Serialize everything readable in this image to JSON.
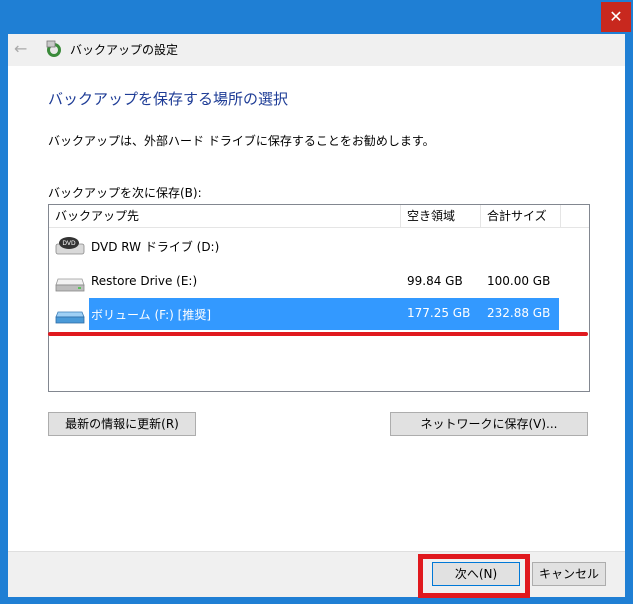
{
  "window": {
    "title": "バックアップの設定",
    "close_glyph": "✕",
    "back_glyph": "←"
  },
  "page": {
    "heading": "バックアップを保存する場所の選択",
    "description": "バックアップは、外部ハード ドライブに保存することをお勧めします。",
    "list_label": "バックアップを次に保存(B):"
  },
  "columns": {
    "destination": "バックアップ先",
    "free_space": "空き領域",
    "total_size": "合計サイズ"
  },
  "drives": [
    {
      "name": "DVD RW ドライブ (D:)",
      "free": "",
      "total": "",
      "icon": "dvd-drive-icon"
    },
    {
      "name": "Restore Drive (E:)",
      "free": "99.84 GB",
      "total": "100.00 GB",
      "icon": "hard-drive-icon"
    },
    {
      "name": "ボリューム (F:) [推奨]",
      "free": "177.25 GB",
      "total": "232.88 GB",
      "icon": "usb-drive-icon"
    }
  ],
  "buttons": {
    "refresh": "最新の情報に更新(R)",
    "network": "ネットワークに保存(V)...",
    "next": "次へ(N)",
    "cancel": "キャンセル"
  },
  "colors": {
    "title_bar": "#1f7fd4",
    "heading": "#1e3c96",
    "selection": "#3399ff",
    "annotation_red": "#e0191e"
  }
}
